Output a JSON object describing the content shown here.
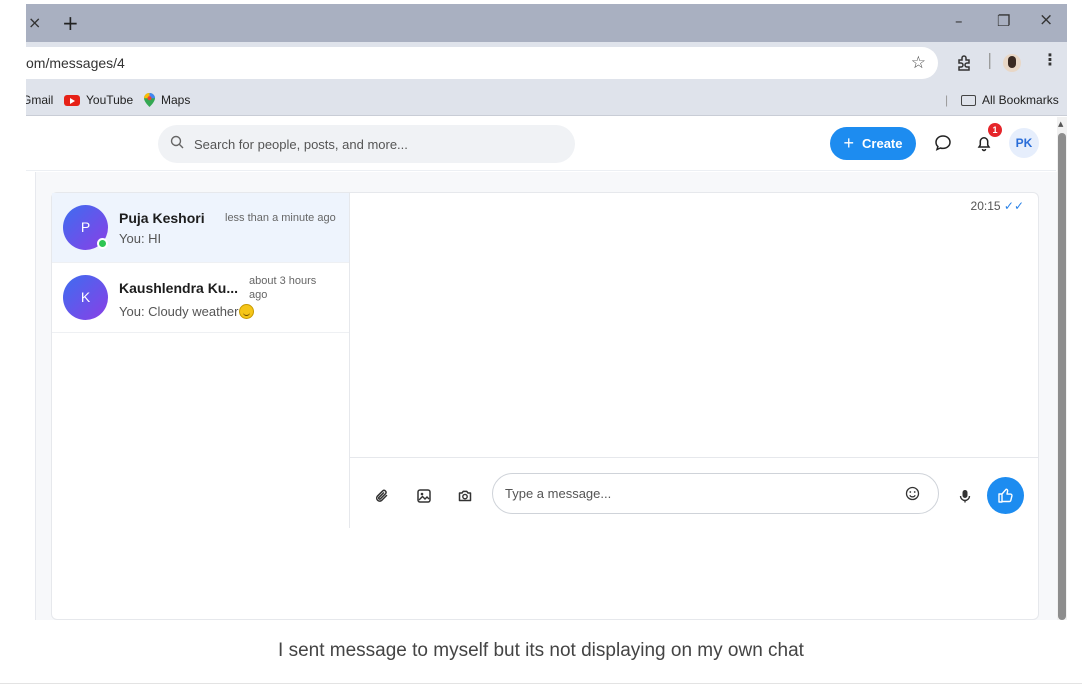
{
  "browser": {
    "tab_close": "×",
    "new_tab": "+",
    "window": {
      "minimize": "–",
      "restore": "❐",
      "close": "×"
    },
    "url": "om/messages/4",
    "bookmarks": [
      {
        "label": "Gmail"
      },
      {
        "label": "YouTube",
        "icon": "youtube-icon"
      },
      {
        "label": "Maps",
        "icon": "maps-pin-icon"
      }
    ],
    "all_bookmarks": "All Bookmarks"
  },
  "header": {
    "search_placeholder": "Search for people, posts, and more...",
    "create_label": "Create",
    "notification_count": "1",
    "user_initials": "PK",
    "accent": "#1d8cf0"
  },
  "conversations": [
    {
      "initial": "P",
      "name": "Puja Keshori",
      "preview": "You: HI",
      "time": "less than a minute ago",
      "online": true,
      "active": true
    },
    {
      "initial": "K",
      "name": "Kaushlendra Ku...",
      "preview": "You: Cloudy weather",
      "time_line1": "about 3 hours",
      "time_line2": "ago",
      "emoji": "smile",
      "online": false,
      "active": false
    }
  ],
  "chat": {
    "message_time": "20:15",
    "read_ticks": "✓✓",
    "composer_placeholder": "Type a message..."
  },
  "caption": "I sent message to myself but its not displaying on my own chat"
}
